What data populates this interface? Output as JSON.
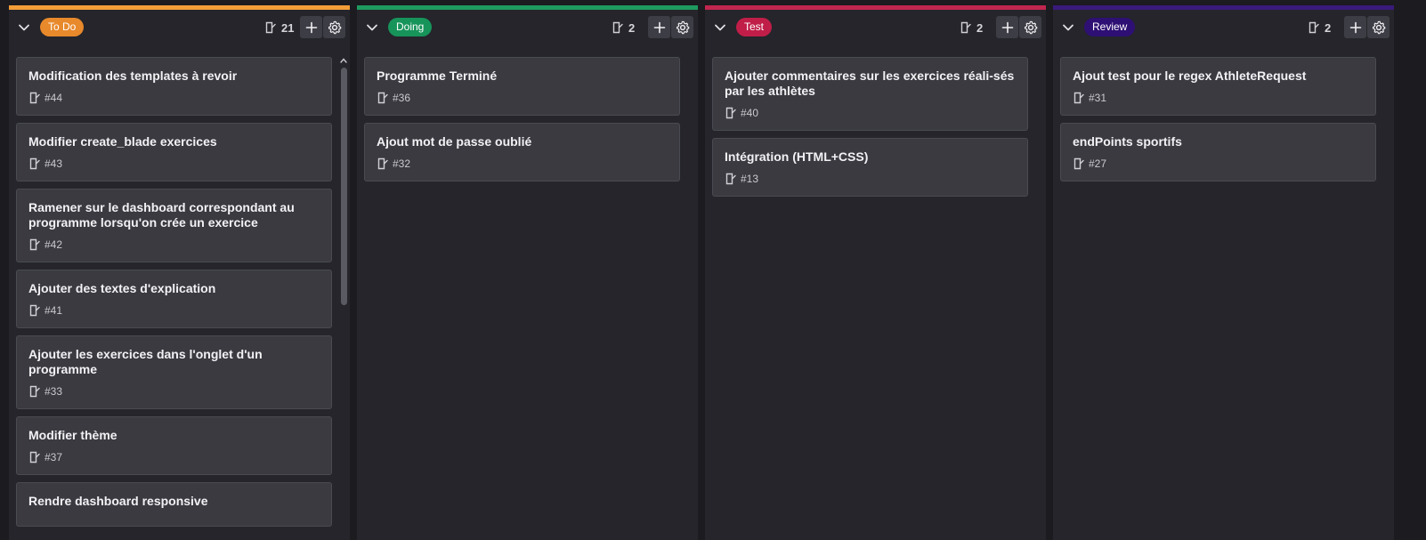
{
  "columns": [
    {
      "name": "To Do",
      "count": "21",
      "accent": "#f29d38",
      "badge_color": "#e8892b",
      "cards": [
        {
          "title": "Modification des templates à revoir",
          "number": "#44"
        },
        {
          "title": "Modifier create_blade exercices",
          "number": "#43"
        },
        {
          "title": "Ramener sur le dashboard correspondant au programme lorsqu'on crée un exercice",
          "number": "#42"
        },
        {
          "title": "Ajouter des textes d'explication",
          "number": "#41"
        },
        {
          "title": "Ajouter les exercices dans l'onglet d'un programme",
          "number": "#33"
        },
        {
          "title": "Modifier thème",
          "number": "#37"
        },
        {
          "title": "Rendre dashboard responsive",
          "number": ""
        }
      ]
    },
    {
      "name": "Doing",
      "count": "2",
      "accent": "#1e9a5e",
      "badge_color": "#17945a",
      "cards": [
        {
          "title": "Programme Terminé",
          "number": "#36"
        },
        {
          "title": "Ajout mot de passe oublié",
          "number": "#32"
        }
      ]
    },
    {
      "name": "Test",
      "count": "2",
      "accent": "#c0264e",
      "badge_color": "#c01e48",
      "cards": [
        {
          "title": "Ajouter commentaires sur les exercices réali-sés par les athlètes",
          "number": "#40"
        },
        {
          "title": "Intégration (HTML+CSS)",
          "number": "#13"
        }
      ]
    },
    {
      "name": "Review",
      "count": "2",
      "accent": "#3a1a7a",
      "badge_color": "#2e0f73",
      "cards": [
        {
          "title": "Ajout test pour le regex AthleteRequest",
          "number": "#31"
        },
        {
          "title": "endPoints sportifs",
          "number": "#27"
        }
      ]
    }
  ],
  "icons": {
    "collapse": "chevron-down-icon",
    "count": "issue-icon",
    "add": "plus-icon",
    "settings": "gear-icon",
    "card": "issue-icon"
  }
}
